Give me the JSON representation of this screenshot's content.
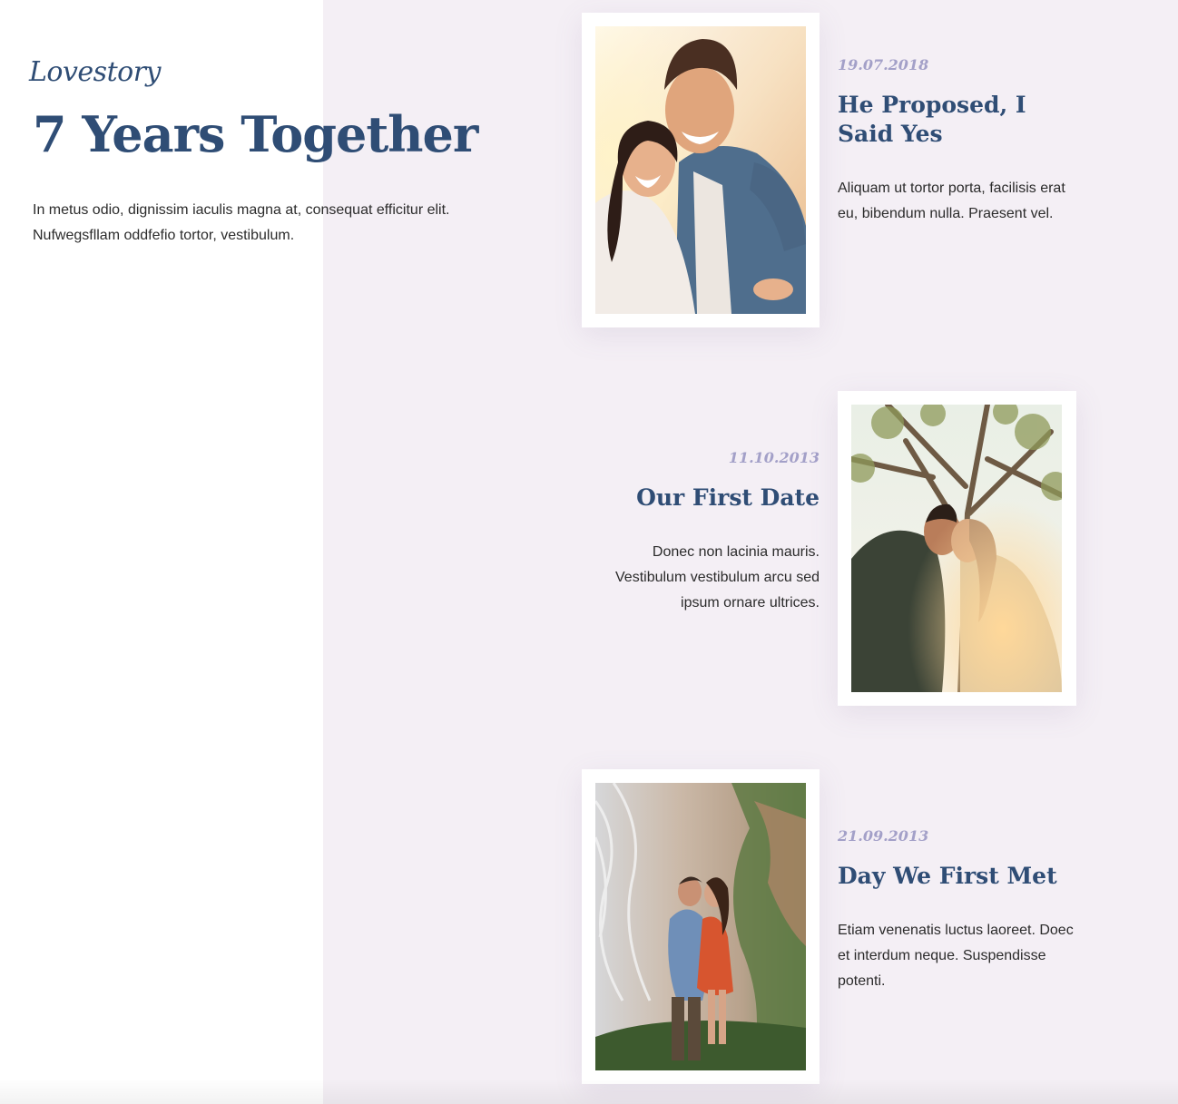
{
  "intro": {
    "script_title": "Lovestory",
    "title": "7 Years Together",
    "text": "In metus odio, dignissim iaculis magna at, consequat efficitur elit. Nufwegsfllam oddfefio tortor, vestibulum."
  },
  "timeline": [
    {
      "date": "19.07.2018",
      "title": "He Proposed, I Said Yes",
      "body": "Aliquam ut tortor porta, facilisis erat eu, bibendum nulla. Praesent vel."
    },
    {
      "date": "11.10.2013",
      "title": "Our First Date",
      "body": "Donec non lacinia mauris. Vestibulum vestibulum arcu sed ipsum ornare ultrices."
    },
    {
      "date": "21.09.2013",
      "title": "Day We First Met",
      "body": "Etiam venenatis luctus laoreet. Doec et interdum neque. Suspendisse potenti."
    }
  ],
  "colors": {
    "title": "#2f4d75",
    "date": "#a3a0c8",
    "panel_bg": "#f4eff5",
    "text": "#2b2b2b"
  }
}
